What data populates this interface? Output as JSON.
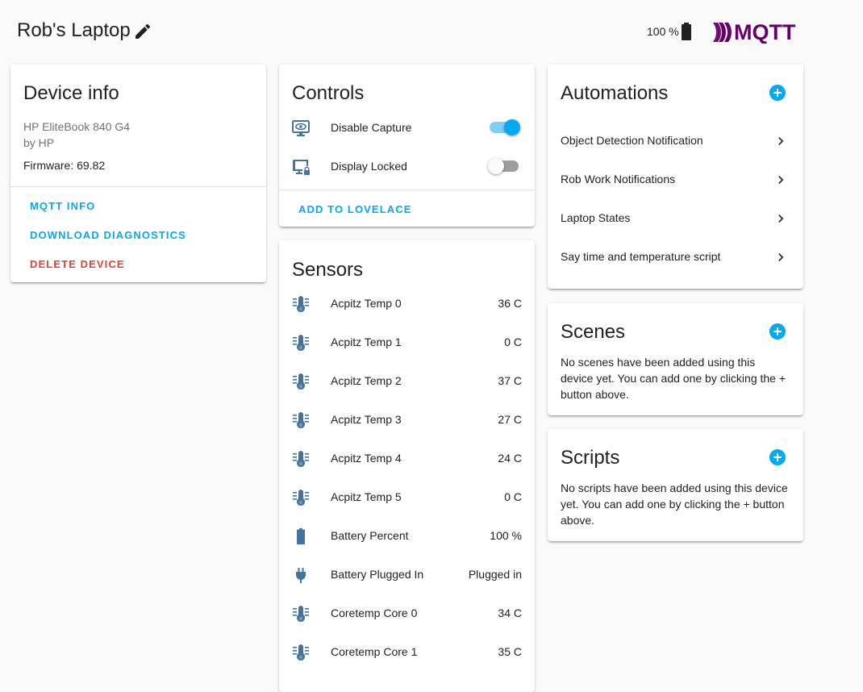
{
  "header": {
    "title": "Rob's Laptop",
    "battery_text": "100 %",
    "logo_text": "MQTT"
  },
  "device_info": {
    "title": "Device info",
    "model": "HP EliteBook 840 G4",
    "manufacturer": "by HP",
    "firmware": "Firmware: 69.82",
    "actions": {
      "mqtt_info": "MQTT INFO",
      "download_diagnostics": "DOWNLOAD DIAGNOSTICS",
      "delete_device": "DELETE DEVICE"
    }
  },
  "controls": {
    "title": "Controls",
    "items": [
      {
        "label": "Disable Capture",
        "icon": "eye-monitor-icon",
        "state": "on"
      },
      {
        "label": "Display Locked",
        "icon": "monitor-lock-icon",
        "state": "off"
      }
    ],
    "add_to_lovelace": "ADD TO LOVELACE"
  },
  "sensors": {
    "title": "Sensors",
    "items": [
      {
        "label": "Acpitz Temp 0",
        "value": "36 C",
        "icon": "thermometer-lines-icon"
      },
      {
        "label": "Acpitz Temp 1",
        "value": "0 C",
        "icon": "thermometer-lines-icon"
      },
      {
        "label": "Acpitz Temp 2",
        "value": "37 C",
        "icon": "thermometer-lines-icon"
      },
      {
        "label": "Acpitz Temp 3",
        "value": "27 C",
        "icon": "thermometer-lines-icon"
      },
      {
        "label": "Acpitz Temp 4",
        "value": "24 C",
        "icon": "thermometer-lines-icon"
      },
      {
        "label": "Acpitz Temp 5",
        "value": "0 C",
        "icon": "thermometer-lines-icon"
      },
      {
        "label": "Battery Percent",
        "value": "100 %",
        "icon": "battery-icon"
      },
      {
        "label": "Battery Plugged In",
        "value": "Plugged in",
        "icon": "power-plug-icon"
      },
      {
        "label": "Coretemp Core 0",
        "value": "34 C",
        "icon": "thermometer-lines-icon"
      },
      {
        "label": "Coretemp Core 1",
        "value": "35 C",
        "icon": "thermometer-lines-icon"
      }
    ]
  },
  "automations": {
    "title": "Automations",
    "items": [
      {
        "label": "Object Detection Notification"
      },
      {
        "label": "Rob Work Notifications"
      },
      {
        "label": "Laptop States"
      },
      {
        "label": "Say time and temperature script"
      }
    ]
  },
  "scenes": {
    "title": "Scenes",
    "empty_text": "No scenes have been added using this device yet. You can add one by clicking the + button above."
  },
  "scripts": {
    "title": "Scripts",
    "empty_text": "No scripts have been added using this device yet. You can add one by clicking the + button above."
  },
  "colors": {
    "accent": "#03a9f4",
    "danger": "#db4437",
    "icon": "#44739e",
    "mqtt_logo": "#660066"
  }
}
